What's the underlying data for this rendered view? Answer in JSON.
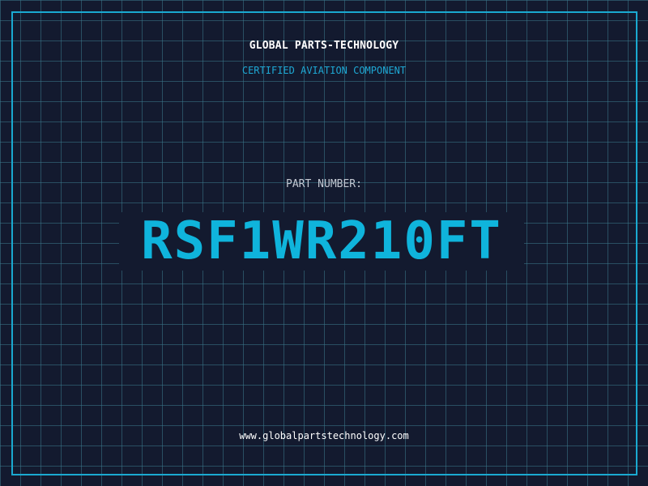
{
  "header": {
    "company": "GLOBAL PARTS-TECHNOLOGY",
    "tagline": "CERTIFIED AVIATION COMPONENT"
  },
  "part": {
    "label": "PART NUMBER:",
    "number": "RSF1WR210FT"
  },
  "footer": {
    "website": "www.globalpartstechnology.com"
  },
  "colors": {
    "background": "#131a2f",
    "grid": "#3a788c",
    "accent": "#1aa9d1",
    "part_number": "#0fb4dc",
    "text_light": "#ffffff",
    "text_muted": "#c3c8d2"
  }
}
